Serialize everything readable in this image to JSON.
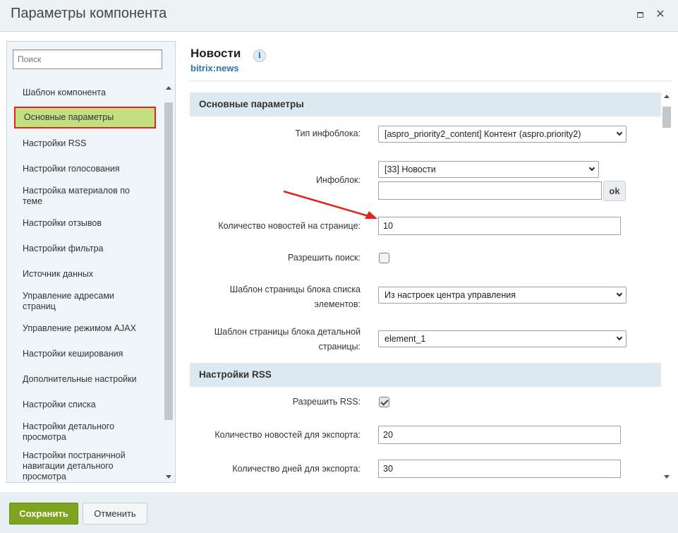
{
  "window": {
    "title": "Параметры компонента"
  },
  "sidebar": {
    "search_placeholder": "Поиск",
    "items": [
      {
        "label": "Шаблон компонента"
      },
      {
        "label": "Основные параметры"
      },
      {
        "label": "Настройки RSS"
      },
      {
        "label": "Настройки голосования"
      },
      {
        "label": "Настройка материалов по теме"
      },
      {
        "label": "Настройки отзывов"
      },
      {
        "label": "Настройки фильтра"
      },
      {
        "label": "Источник данных"
      },
      {
        "label": "Управление адресами страниц"
      },
      {
        "label": "Управление режимом AJAX"
      },
      {
        "label": "Настройки кеширования"
      },
      {
        "label": "Дополнительные настройки"
      },
      {
        "label": "Настройки списка"
      },
      {
        "label": "Настройки детального просмотра"
      },
      {
        "label": "Настройки постраничной навигации детального просмотра"
      }
    ]
  },
  "component": {
    "name": "Новости",
    "code": "bitrix:news",
    "info_icon": "i"
  },
  "sections": {
    "main": {
      "title": "Основные параметры",
      "iblock_type_label": "Тип инфоблока:",
      "iblock_type_value": "[aspro_priority2_content] Контент (aspro.priority2)",
      "iblock_label": "Инфоблок:",
      "iblock_value": "[33] Новости",
      "iblock_extra_value": "",
      "ok_label": "ok",
      "news_count_label": "Количество новостей на странице:",
      "news_count_value": "10",
      "allow_search_label": "Разрешить поиск:",
      "allow_search_checked": false,
      "list_template_label": "Шаблон страницы блока списка элементов:",
      "list_template_value": "Из настроек центра управления",
      "detail_template_label": "Шаблон страницы блока детальной страницы:",
      "detail_template_value": "element_1"
    },
    "rss": {
      "title": "Настройки RSS",
      "allow_rss_label": "Разрешить RSS:",
      "allow_rss_checked": true,
      "export_count_label": "Количество новостей для экспорта:",
      "export_count_value": "20",
      "export_days_label": "Количество дней для экспорта:",
      "export_days_value": "30"
    }
  },
  "footer": {
    "save_label": "Сохранить",
    "cancel_label": "Отменить"
  },
  "colors": {
    "accent_green": "#7ea31e",
    "active_item": "#c4de82",
    "highlight_border": "#e0251a",
    "link_blue": "#2d74a5",
    "annotation_arrow": "#e0251a"
  }
}
